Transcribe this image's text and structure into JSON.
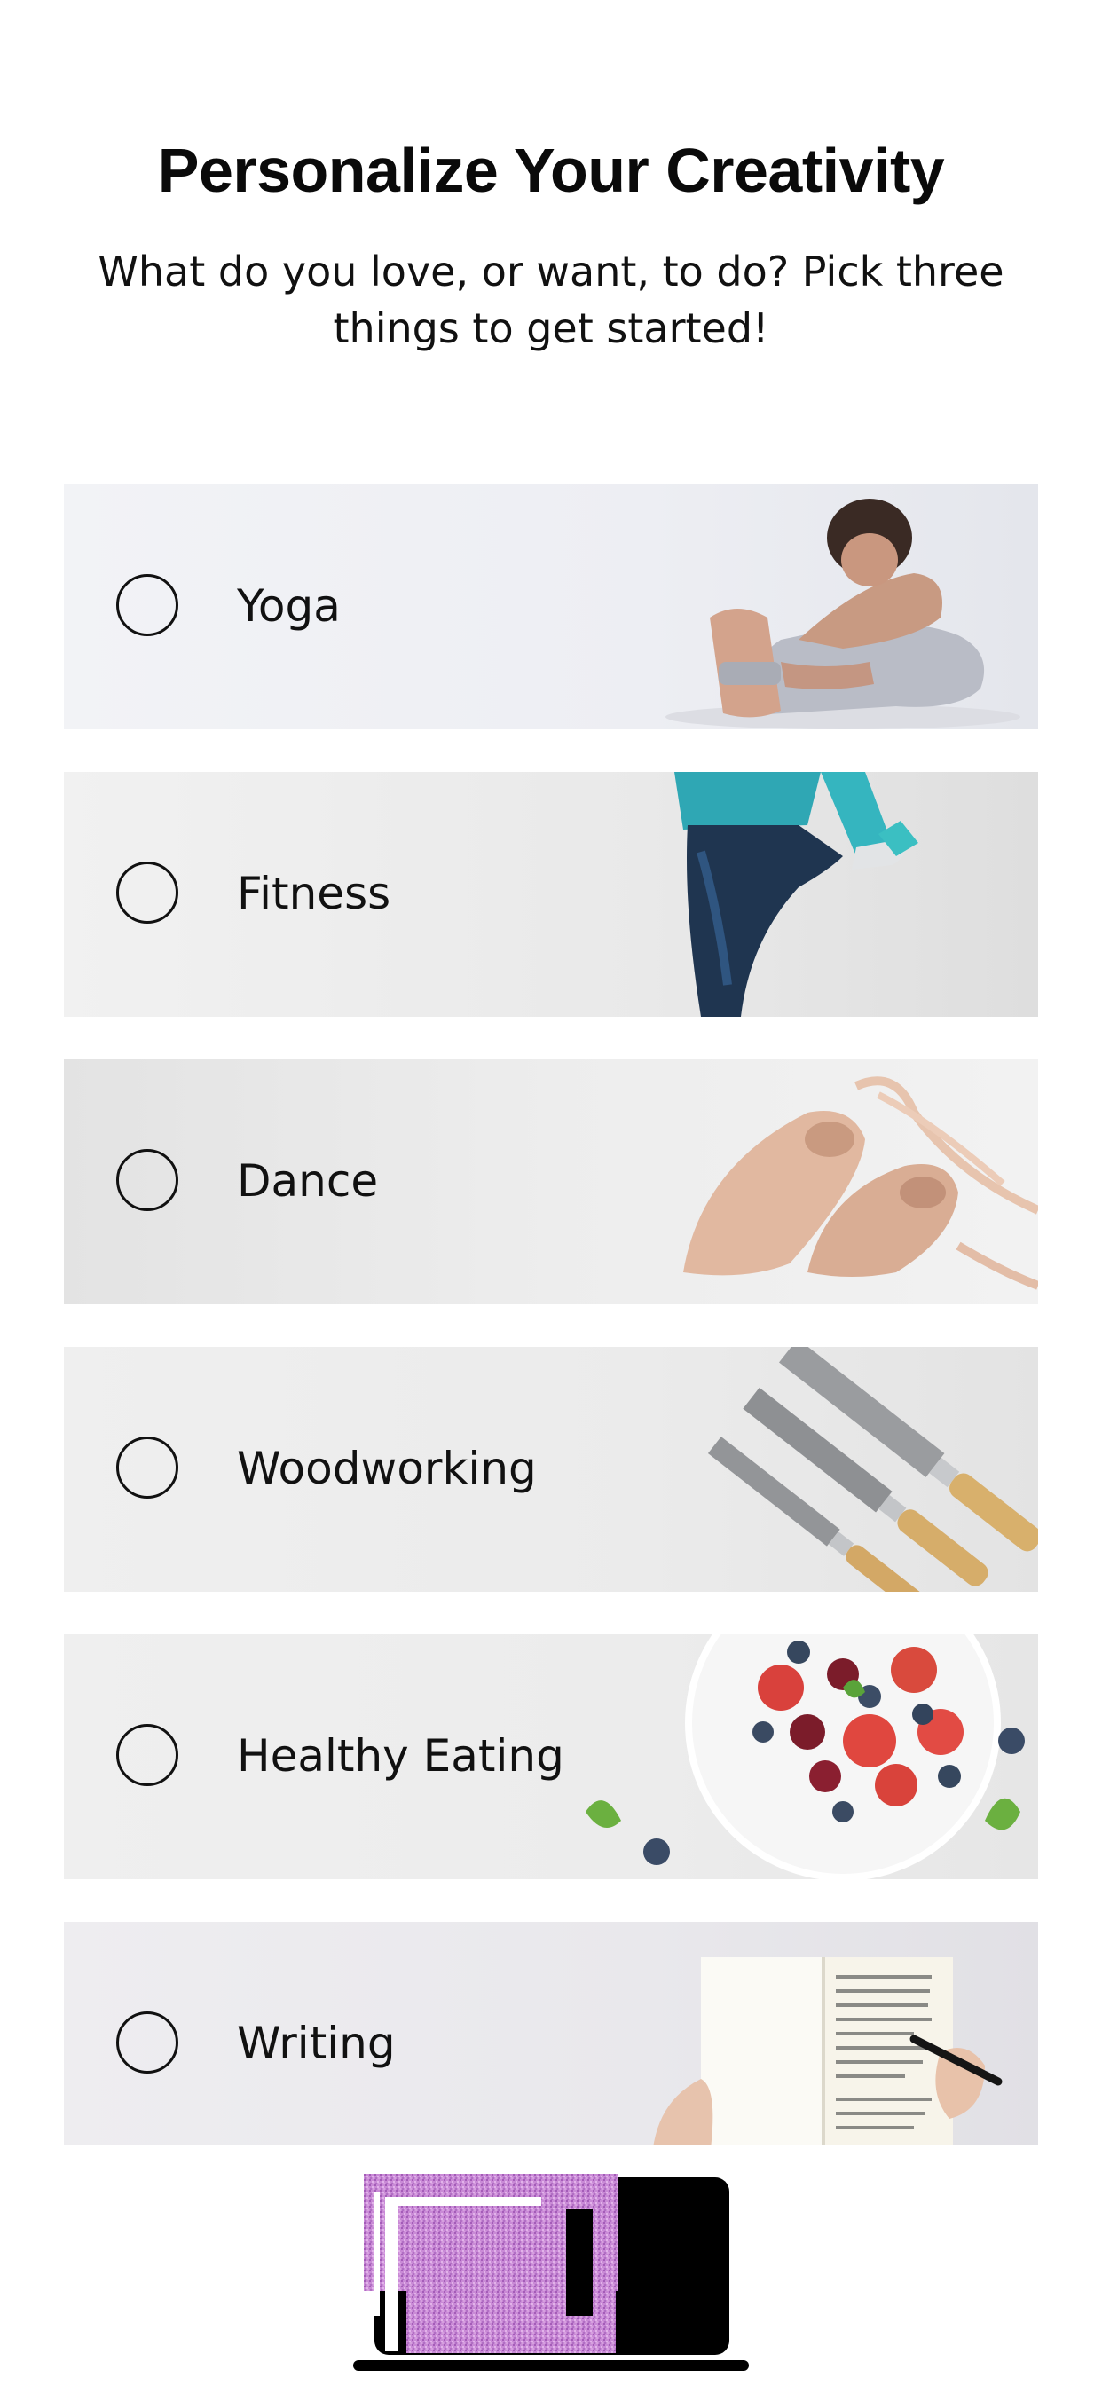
{
  "header": {
    "title": "Personalize Your Creativity",
    "subtitle": "What do you love, or want, to do? Pick three things to get started!"
  },
  "options": [
    {
      "label": "Yoga",
      "image": "yoga-stretch-photo",
      "selected": false
    },
    {
      "label": "Fitness",
      "image": "leg-stretch-photo",
      "selected": false
    },
    {
      "label": "Dance",
      "image": "ballet-shoes-photo",
      "selected": false
    },
    {
      "label": "Woodworking",
      "image": "chisels-photo",
      "selected": false
    },
    {
      "label": "Healthy Eating",
      "image": "berries-bowl-photo",
      "selected": false
    },
    {
      "label": "Writing",
      "image": "notebook-writing-photo",
      "selected": false
    }
  ],
  "footer": {
    "icon": "laptop-devices-icon"
  },
  "colors": {
    "radio_border": "#111111",
    "background": "#ffffff",
    "device": "#000000",
    "placeholder_pink": "#c98ad6"
  }
}
